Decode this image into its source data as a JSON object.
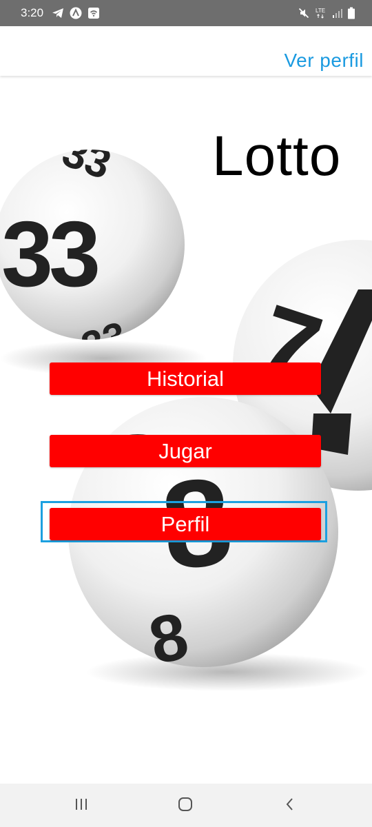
{
  "status_bar": {
    "time": "3:20",
    "network_label": "LTE",
    "icons": [
      "telegram-icon",
      "app-a-icon",
      "wifi-box-icon",
      "mute-icon",
      "lte-icon",
      "signal-icon",
      "battery-icon"
    ]
  },
  "app_bar": {
    "profile_link": "Ver perfil",
    "link_color": "#1a9ae0"
  },
  "main": {
    "title": "Lotto",
    "buttons": [
      {
        "label": "Historial"
      },
      {
        "label": "Jugar"
      },
      {
        "label": "Perfil"
      }
    ],
    "button_color": "#ff0000",
    "focused_button": "Perfil",
    "focus_color": "#1ca0e0",
    "background_balls": [
      "33",
      "33",
      "33",
      "7",
      "8",
      "8"
    ]
  },
  "nav_bar": {
    "icons": [
      "recents-icon",
      "home-icon",
      "back-icon"
    ]
  }
}
